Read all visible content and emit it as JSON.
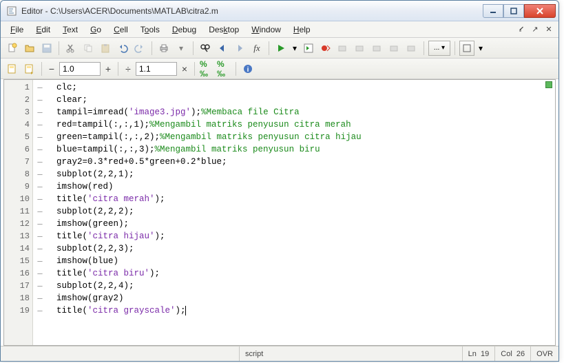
{
  "window": {
    "title": "Editor - C:\\Users\\ACER\\Documents\\MATLAB\\citra2.m"
  },
  "menu": {
    "file": "File",
    "edit": "Edit",
    "text": "Text",
    "go": "Go",
    "cell": "Cell",
    "tools": "Tools",
    "debug": "Debug",
    "desktop": "Desktop",
    "window": "Window",
    "help": "Help"
  },
  "toolbar2": {
    "field1": "1.0",
    "field2": "1.1"
  },
  "code": {
    "lines": [
      {
        "n": "1",
        "t": "clc;"
      },
      {
        "n": "2",
        "t": "clear;"
      },
      {
        "n": "3",
        "t": "tampil=imread('image3.jpg');%Membaca file Citra"
      },
      {
        "n": "4",
        "t": "red=tampil(:,:,1);%Mengambil matriks penyusun citra merah"
      },
      {
        "n": "5",
        "t": "green=tampil(:,:,2);%Mengambil matriks penyusun citra hijau"
      },
      {
        "n": "6",
        "t": "blue=tampil(:,:,3);%Mengambil matriks penyusun biru"
      },
      {
        "n": "7",
        "t": "gray2=0.3*red+0.5*green+0.2*blue;"
      },
      {
        "n": "8",
        "t": "subplot(2,2,1);"
      },
      {
        "n": "9",
        "t": "imshow(red)"
      },
      {
        "n": "10",
        "t": "title('citra merah');"
      },
      {
        "n": "11",
        "t": "subplot(2,2,2);"
      },
      {
        "n": "12",
        "t": "imshow(green);"
      },
      {
        "n": "13",
        "t": "title('citra hijau');"
      },
      {
        "n": "14",
        "t": "subplot(2,2,3);"
      },
      {
        "n": "15",
        "t": "imshow(blue)"
      },
      {
        "n": "16",
        "t": "title('citra biru');"
      },
      {
        "n": "17",
        "t": "subplot(2,2,4);"
      },
      {
        "n": "18",
        "t": "imshow(gray2)"
      },
      {
        "n": "19",
        "t": "title('citra grayscale');"
      }
    ]
  },
  "status": {
    "type": "script",
    "ln_label": "Ln",
    "ln": "19",
    "col_label": "Col",
    "col": "26",
    "ovr": "OVR"
  }
}
